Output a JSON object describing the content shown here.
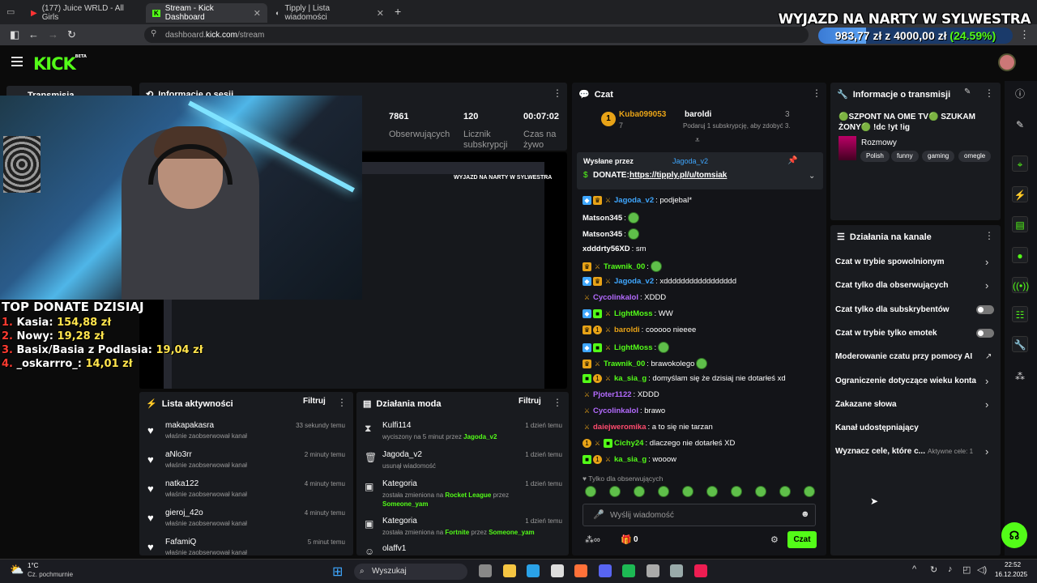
{
  "browser": {
    "tabs": [
      {
        "label": "(177) Juice WRLD - All Girls",
        "icon": "youtube-icon"
      },
      {
        "label": "Stream - Kick Dashboard",
        "icon": "kick-icon"
      },
      {
        "label": "Tipply | Lista wiadomości",
        "icon": "tipply-icon"
      }
    ],
    "url_prefix": "dashboard.",
    "url_domain": "kick.com",
    "url_path": "/stream"
  },
  "overlay": {
    "title": "WYJAZD NA NARTY W SYLWESTRA",
    "current": "983,77 zł",
    "sep": "z",
    "goal": "4000,00 zł",
    "percent": "(24.59%)",
    "progress_fraction": 0.2459
  },
  "kick": {
    "logo": "KICK",
    "beta": "BETA",
    "sidebar_item": "Transmisja"
  },
  "donates": {
    "title": "TOP DONATE DZISIAJ",
    "items": [
      {
        "n": "1.",
        "name": "Kasia:",
        "amt": "154,88 zł"
      },
      {
        "n": "2.",
        "name": "Nowy:",
        "amt": "19,28 zł"
      },
      {
        "n": "3.",
        "name": "Basix/Basia z Podlasia:",
        "amt": "19,04 zł"
      },
      {
        "n": "4.",
        "name": "_oskarrro_:",
        "amt": "14,01 zł"
      }
    ]
  },
  "session": {
    "title": "Informacje o sesji",
    "stats": [
      {
        "value": "7861",
        "label": "Obserwujących"
      },
      {
        "value": "120",
        "label": "Licznik subskrypcji"
      },
      {
        "value": "00:07:02",
        "label": "Czas na żywo"
      }
    ]
  },
  "activity": {
    "title": "Lista aktywności",
    "filter": "Filtruj",
    "rows": [
      {
        "name": "makapakasra",
        "sub": "właśnie zaobserwował kanał",
        "time": "33 sekundy temu"
      },
      {
        "name": "aNlo3rr",
        "sub": "właśnie zaobserwował kanał",
        "time": "2 minuty temu"
      },
      {
        "name": "natka122",
        "sub": "właśnie zaobserwował kanał",
        "time": "4 minuty temu"
      },
      {
        "name": "gieroj_42o",
        "sub": "właśnie zaobserwował kanał",
        "time": "4 minuty temu"
      },
      {
        "name": "FafamiQ",
        "sub": "właśnie zaobserwował kanał",
        "time": "5 minut temu"
      }
    ]
  },
  "mod": {
    "title": "Działania moda",
    "filter": "Filtruj",
    "rows": [
      {
        "icon": "hourglass-icon",
        "name": "Kulfi114",
        "sub_a": "wyciszony na 5 minut przez",
        "g1": "Jagoda_v2",
        "sub_b": "",
        "g2": "",
        "time": "1 dzień temu"
      },
      {
        "icon": "trash-icon",
        "name": "Jagoda_v2",
        "sub_a": "usunął wiadomość",
        "g1": "",
        "sub_b": "",
        "g2": "",
        "time": "1 dzień temu"
      },
      {
        "icon": "category-icon",
        "name": "Kategoria",
        "sub_a": "została zmieniona na",
        "g1": "Rocket League",
        "sub_b": "przez",
        "g2": "Someone_yam",
        "time": "1 dzień temu"
      },
      {
        "icon": "category-icon",
        "name": "Kategoria",
        "sub_a": "została zmieniona na",
        "g1": "Fortnite",
        "sub_b": "przez",
        "g2": "Someone_yam",
        "time": "1 dzień temu"
      },
      {
        "icon": "user-icon",
        "name": "olaffv1",
        "sub_a": "",
        "g1": "",
        "sub_b": "",
        "g2": "",
        "time": ""
      }
    ]
  },
  "chat": {
    "title": "Czat",
    "top_gifter": {
      "rank": "1",
      "name": "Kuba099053",
      "count": "7"
    },
    "gift_user": {
      "name": "baroldi",
      "count": "3",
      "text": "Podaruj 1 subskrypcję, aby zdobyć 3."
    },
    "pinned": {
      "sent_by": "Wysłane przez",
      "user": "Jagoda_v2",
      "label": "DONATE:",
      "link": "https://tipply.pl/u/tomsiak"
    },
    "messages": [
      {
        "user": "Jagoda_v2",
        "color": "#3fa7ff",
        "badges": [
          "vip",
          "crown",
          "sword"
        ],
        "text": ": podjebal*"
      },
      {
        "user": "Matson345",
        "color": "#ffffff",
        "badges": [],
        "text": ":",
        "emote": true
      },
      {
        "user": "Matson345",
        "color": "#ffffff",
        "badges": [],
        "text": ":",
        "emote": true
      },
      {
        "user": "xdddrty56XD",
        "color": "#ffffff",
        "badges": [],
        "text": ": sm"
      },
      {
        "user": "Trawnik_00",
        "color": "#53fc18",
        "badges": [
          "crown",
          "sword"
        ],
        "text": ":",
        "emote": true
      },
      {
        "user": "Jagoda_v2",
        "color": "#3fa7ff",
        "badges": [
          "vip",
          "crown",
          "sword"
        ],
        "text": ": xddddddddddddddddd"
      },
      {
        "user": "Cycolinkalol",
        "color": "#b46bff",
        "badges": [
          "sword"
        ],
        "text": ": XDDD"
      },
      {
        "user": "LightMoss",
        "color": "#53fc18",
        "badges": [
          "vip",
          "sub",
          "sword"
        ],
        "text": ": WW"
      },
      {
        "user": "baroldi",
        "color": "#e8a317",
        "badges": [
          "crown",
          "num",
          "sword"
        ],
        "text": ": cooooo nieeee"
      },
      {
        "user": "LightMoss",
        "color": "#53fc18",
        "badges": [
          "vip",
          "sub",
          "sword"
        ],
        "text": ":",
        "emote": true
      },
      {
        "user": "Trawnik_00",
        "color": "#53fc18",
        "badges": [
          "crown",
          "sword"
        ],
        "text": ": brawokolego",
        "emote": true
      },
      {
        "user": "ka_sia_g",
        "color": "#53fc18",
        "badges": [
          "sub",
          "num",
          "sword"
        ],
        "text": ": domyślam się że dzisiaj nie dotarłeś xd"
      },
      {
        "user": "Pjoter1122",
        "color": "#b46bff",
        "badges": [
          "sword"
        ],
        "text": ": XDDD"
      },
      {
        "user": "Cycolinkalol",
        "color": "#b46bff",
        "badges": [
          "sword"
        ],
        "text": ": brawo"
      },
      {
        "user": "daiejweromika",
        "color": "#ff4b6e",
        "badges": [
          "sword"
        ],
        "text": ": a to się nie tarzan"
      },
      {
        "user": "Cichy24",
        "color": "#53fc18",
        "badges": [
          "num",
          "sword",
          "sub"
        ],
        "text": ": dlaczego nie dotarłeś XD"
      },
      {
        "user": "ka_sia_g",
        "color": "#53fc18",
        "badges": [
          "sub",
          "num",
          "sword"
        ],
        "text": ": wooow"
      }
    ],
    "followers_only": "Tylko dla obserwujących",
    "placeholder": "Wyślij wiadomość",
    "points": "0",
    "send": "Czat"
  },
  "stream_info": {
    "title": "Informacje o transmisji",
    "stream_title": "🟢SZPONT NA OME TV🟢 SZUKAM ŻONY🟢 !dc !yt !ig",
    "category": "Rozmowy",
    "tags": [
      "Polish",
      "funny",
      "gaming",
      "omegle"
    ]
  },
  "channel_actions": {
    "title": "Działania na kanale",
    "items": [
      {
        "label": "Czat w trybie spowolnionym",
        "kind": "chevron"
      },
      {
        "label": "Czat tylko dla obserwujących",
        "kind": "chevron"
      },
      {
        "label": "Czat tylko dla subskrybentów",
        "kind": "toggle",
        "on": false
      },
      {
        "label": "Czat w trybie tylko emotek",
        "kind": "toggle",
        "on": false
      },
      {
        "label": "Moderowanie czatu przy pomocy AI",
        "kind": "external"
      },
      {
        "label": "Ograniczenie dotyczące wieku konta",
        "kind": "chevron"
      },
      {
        "label": "Zakazane słowa",
        "kind": "chevron"
      },
      {
        "label": "Kanał udostępniający",
        "kind": "none"
      },
      {
        "label": "Wyznacz cele, które c...",
        "kind": "chevron",
        "extra": "Aktywne cele: 1"
      }
    ]
  },
  "taskbar": {
    "temp": "1°C",
    "weather": "Cz. pochmurnie",
    "search": "Wyszukaj",
    "time": "22:52",
    "date": "16.12.2025"
  },
  "colors": {
    "kick_green": "#53fc18",
    "panel": "#191b1f",
    "bg": "#0b0b0b"
  }
}
